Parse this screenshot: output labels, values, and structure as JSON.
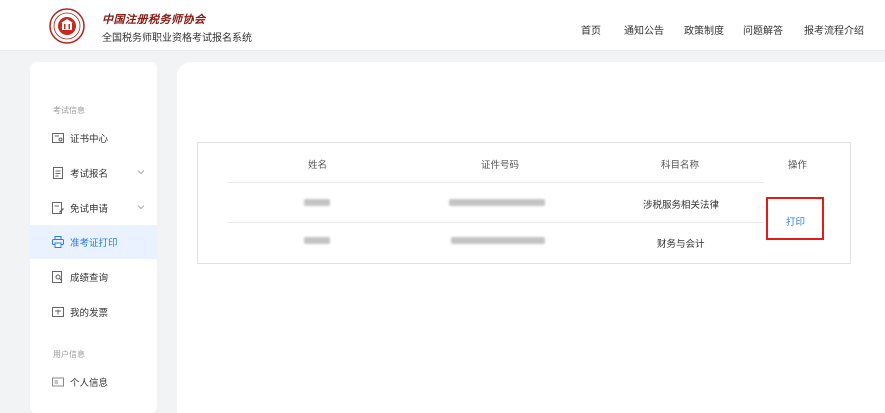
{
  "header": {
    "brand_title": "中国注册税务师协会",
    "brand_subtitle": "全国税务师职业资格考试报名系统",
    "nav": [
      "首页",
      "通知公告",
      "政策制度",
      "问题解答",
      "报考流程介绍"
    ]
  },
  "sidebar": {
    "section_exam": "考试信息",
    "section_user": "用户信息",
    "items": [
      {
        "label": "证书中心",
        "icon": "certificate-icon"
      },
      {
        "label": "考试报名",
        "icon": "form-icon",
        "expandable": true
      },
      {
        "label": "免试申请",
        "icon": "edit-doc-icon",
        "expandable": true
      },
      {
        "label": "准考证打印",
        "icon": "printer-icon",
        "active": true
      },
      {
        "label": "成绩查询",
        "icon": "search-doc-icon"
      },
      {
        "label": "我的发票",
        "icon": "invoice-icon"
      },
      {
        "label": "个人信息",
        "icon": "id-card-icon"
      }
    ]
  },
  "table": {
    "headers": [
      "姓名",
      "证件号码",
      "科目名称",
      "操作"
    ],
    "rows": [
      {
        "subject": "涉税服务相关法律"
      },
      {
        "subject": "财务与会计"
      }
    ],
    "action_label": "打印"
  },
  "colors": {
    "accent": "#2b7de9",
    "highlight_border": "#e21b1b",
    "brand": "#8a1a14"
  }
}
